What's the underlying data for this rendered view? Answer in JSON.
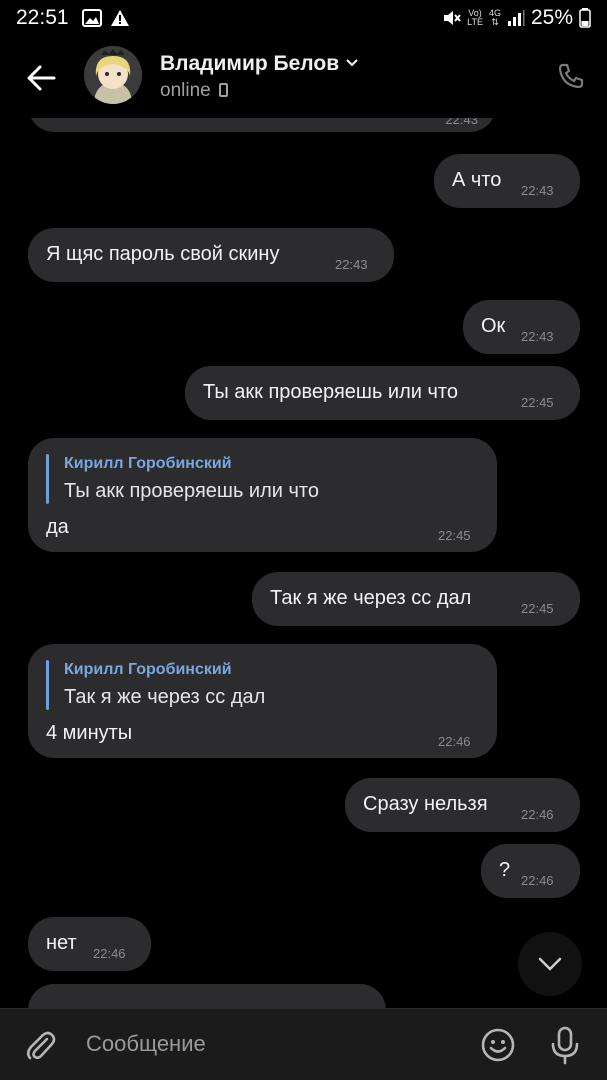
{
  "status_bar": {
    "time": "22:51",
    "net_top": "Vo)",
    "net_bottom": "LTE",
    "g4": "4G",
    "battery": "25%"
  },
  "header": {
    "contact_name": "Владимир Белов",
    "status": "online"
  },
  "messages": [
    {
      "time": "22:43"
    },
    {
      "text": "А что",
      "time": "22:43"
    },
    {
      "text": "Я щяс пароль свой скину",
      "time": "22:43"
    },
    {
      "text": "Ок",
      "time": "22:43"
    },
    {
      "text": "Ты акк проверяешь или что",
      "time": "22:45"
    },
    {
      "reply_author": "Кирилл Горобинский",
      "reply_text": "Ты акк проверяешь или что",
      "text": "да",
      "time": "22:45"
    },
    {
      "text": "Так я же через сс дал",
      "time": "22:45"
    },
    {
      "reply_author": "Кирилл Горобинский",
      "reply_text": "Так я же через сс дал",
      "text": "4 минуты",
      "time": "22:46"
    },
    {
      "text": "Сразу нельзя",
      "time": "22:46"
    },
    {
      "text": "?",
      "time": "22:46"
    },
    {
      "text": "нет",
      "time": "22:46"
    }
  ],
  "composer": {
    "placeholder": "Сообщение"
  },
  "colors": {
    "bubble": "#2c2c2e",
    "accent": "#7aa7e0",
    "background": "#000000"
  }
}
